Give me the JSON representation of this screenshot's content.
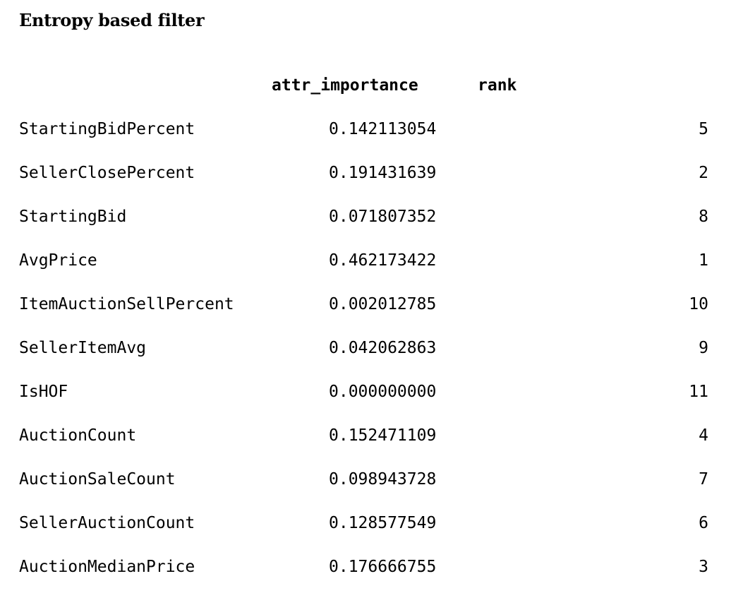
{
  "title": "Entropy based filter",
  "table": {
    "headers": {
      "importance": "attr_importance",
      "rank": "rank"
    },
    "rows": [
      {
        "name": "StartingBidPercent",
        "importance": "0.142113054",
        "rank": "5"
      },
      {
        "name": "SellerClosePercent",
        "importance": "0.191431639",
        "rank": "2"
      },
      {
        "name": "StartingBid",
        "importance": "0.071807352",
        "rank": "8"
      },
      {
        "name": "AvgPrice",
        "importance": "0.462173422",
        "rank": "1"
      },
      {
        "name": "ItemAuctionSellPercent",
        "importance": "0.002012785",
        "rank": "10"
      },
      {
        "name": "SellerItemAvg",
        "importance": "0.042062863",
        "rank": "9"
      },
      {
        "name": "IsHOF",
        "importance": "0.000000000",
        "rank": "11"
      },
      {
        "name": "AuctionCount",
        "importance": "0.152471109",
        "rank": "4"
      },
      {
        "name": "AuctionSaleCount",
        "importance": "0.098943728",
        "rank": "7"
      },
      {
        "name": "SellerAuctionCount",
        "importance": "0.128577549",
        "rank": "6"
      },
      {
        "name": "AuctionMedianPrice",
        "importance": "0.176666755",
        "rank": "3"
      }
    ]
  }
}
